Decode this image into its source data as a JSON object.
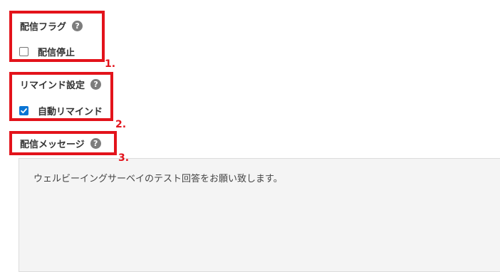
{
  "sections": {
    "delivery_flag": {
      "label": "配信フラグ",
      "checkbox_label": "配信停止",
      "checked": false
    },
    "reminder": {
      "label": "リマインド設定",
      "checkbox_label": "自動リマインド",
      "checked": true
    },
    "message": {
      "label": "配信メッセージ",
      "value": "ウェルビーイングサーベイのテスト回答をお願い致します。"
    }
  },
  "help_icon_glyph": "?",
  "annotations": [
    "1.",
    "2.",
    "3."
  ],
  "colors": {
    "annotation": "#e3131b",
    "checkbox_checked": "#0b75d4",
    "help_icon": "#7d7d7d",
    "textarea_bg": "#f4f4f4"
  },
  "icons": {
    "help": "help-icon",
    "check": "check-icon"
  }
}
